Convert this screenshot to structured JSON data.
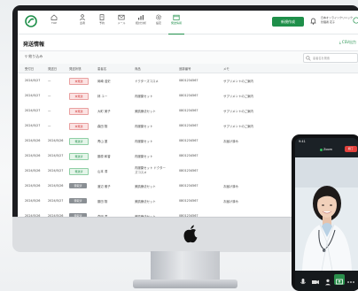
{
  "nav": {
    "items": [
      {
        "label": "TOP",
        "icon": "home-icon"
      },
      {
        "label": "患者",
        "icon": "person-icon"
      },
      {
        "label": "予約",
        "icon": "clipboard-icon"
      },
      {
        "label": "メール",
        "icon": "mail-icon"
      },
      {
        "label": "統計分析",
        "icon": "chart-icon"
      },
      {
        "label": "設定",
        "icon": "gear-icon"
      },
      {
        "label": "発送情報",
        "icon": "calendar-icon"
      }
    ],
    "active_index": 6
  },
  "header": {
    "new_button": "新規作成",
    "user_line1": "日本オンラインクリニック",
    "user_line2": "管理者 花子"
  },
  "page": {
    "title": "発送情報",
    "action": "CSV出力",
    "filter_label": "絞り込み",
    "search_placeholder": "患者名を検索"
  },
  "table": {
    "headers": [
      "受付日",
      "発送日",
      "発送状態",
      "患者名",
      "商品",
      "追跡番号",
      "メモ"
    ],
    "rows": [
      {
        "date": "2024/5/27",
        "ship": "—",
        "status": "未発送",
        "status_type": "red",
        "name": "岡崎 浩史",
        "product": "ドクターズコスメ",
        "tracking": "0801234567",
        "memo": "サプリメントのご案内"
      },
      {
        "date": "2024/5/27",
        "ship": "—",
        "status": "未発送",
        "status_type": "red",
        "name": "林 ユー",
        "product": "内服薬セット",
        "tracking": "0801234567",
        "memo": "サプリメントのご案内"
      },
      {
        "date": "2024/5/27",
        "ship": "—",
        "status": "未発送",
        "status_type": "red",
        "name": "大町 美子",
        "product": "美肌療法セット",
        "tracking": "0801234567",
        "memo": "サプリメントのご案内"
      },
      {
        "date": "2024/5/27",
        "ship": "—",
        "status": "未発送",
        "status_type": "red",
        "name": "森田 翔",
        "product": "内服薬セット",
        "tracking": "0801234567",
        "memo": "サプリメントのご案内"
      },
      {
        "date": "2024/5/26",
        "ship": "2024/5/26",
        "status": "発送済",
        "status_type": "green",
        "name": "青山 蓮",
        "product": "内服薬セット",
        "tracking": "0801234567",
        "memo": "お届け済み"
      },
      {
        "date": "2024/5/26",
        "ship": "2024/5/27",
        "status": "発送済",
        "status_type": "green",
        "name": "藤原 和香",
        "product": "内服薬セット",
        "tracking": "0801234567",
        "memo": ""
      },
      {
        "date": "2024/5/26",
        "ship": "2024/5/27",
        "status": "発送済",
        "status_type": "green",
        "name": "山本 澪",
        "product": "内服薬セット ドクターズコスメ",
        "tracking": "0801234567",
        "memo": ""
      },
      {
        "date": "2024/5/26",
        "ship": "2024/5/26",
        "status": "受取済",
        "status_type": "gray",
        "name": "渡辺 雅子",
        "product": "美肌療法セット",
        "tracking": "0801234567",
        "memo": "お届け済み"
      },
      {
        "date": "2024/5/26",
        "ship": "2024/5/27",
        "status": "受取済",
        "status_type": "gray",
        "name": "藤田 翔",
        "product": "美肌療法セット",
        "tracking": "0801234567",
        "memo": "お届け済み"
      },
      {
        "date": "2024/5/26",
        "ship": "2024/5/26",
        "status": "受取済",
        "status_type": "gray",
        "name": "森田 澪",
        "product": "美肌療法セット",
        "tracking": "0801234567",
        "memo": ""
      }
    ]
  },
  "phone": {
    "time": "9:41",
    "zoom_label": "Zoom",
    "end_label": "終了"
  },
  "colors": {
    "accent": "#1f8f4a",
    "danger": "#e2413c"
  }
}
